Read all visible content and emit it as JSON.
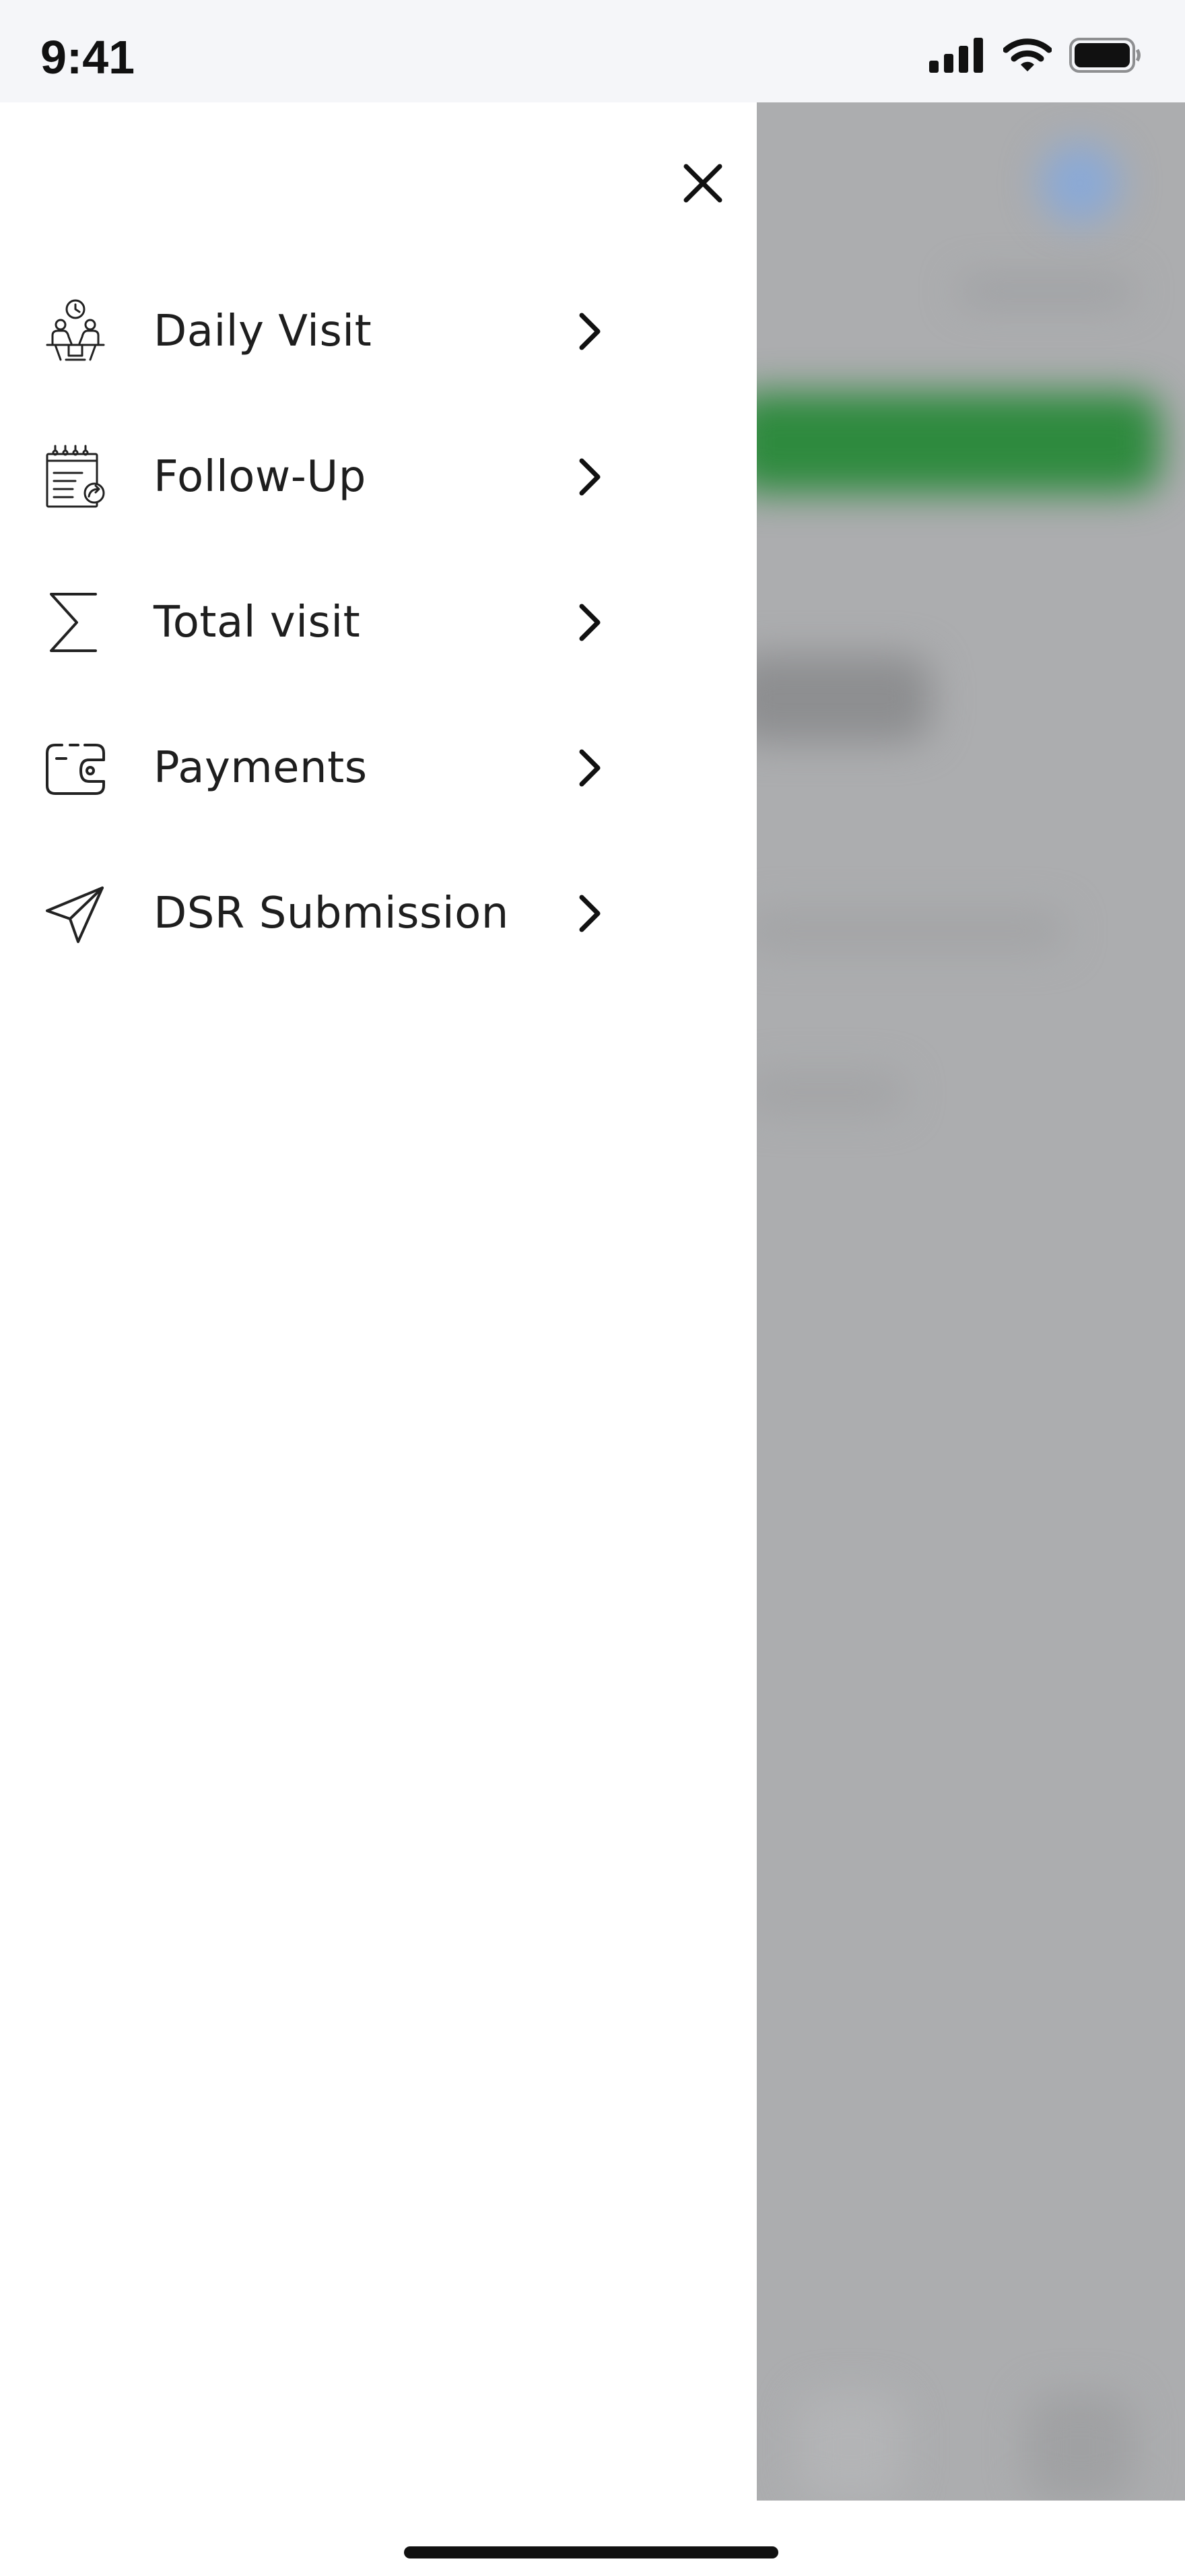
{
  "status_bar": {
    "time": "9:41",
    "icons": [
      "signal-icon",
      "wifi-icon",
      "battery-icon"
    ]
  },
  "drawer": {
    "close_icon": "close-icon",
    "items": [
      {
        "label": "Daily Visit",
        "icon": "daily-visit-icon"
      },
      {
        "label": "Follow-Up",
        "icon": "follow-up-icon"
      },
      {
        "label": "Total visit",
        "icon": "sigma-icon"
      },
      {
        "label": "Payments",
        "icon": "wallet-icon"
      },
      {
        "label": "DSR Submission",
        "icon": "send-icon"
      }
    ]
  },
  "colors": {
    "text": "#1e1e1e",
    "overlay": "#acadaf",
    "backdrop_green": "#2e8a3e",
    "backdrop_blue": "#8aa9d6"
  }
}
